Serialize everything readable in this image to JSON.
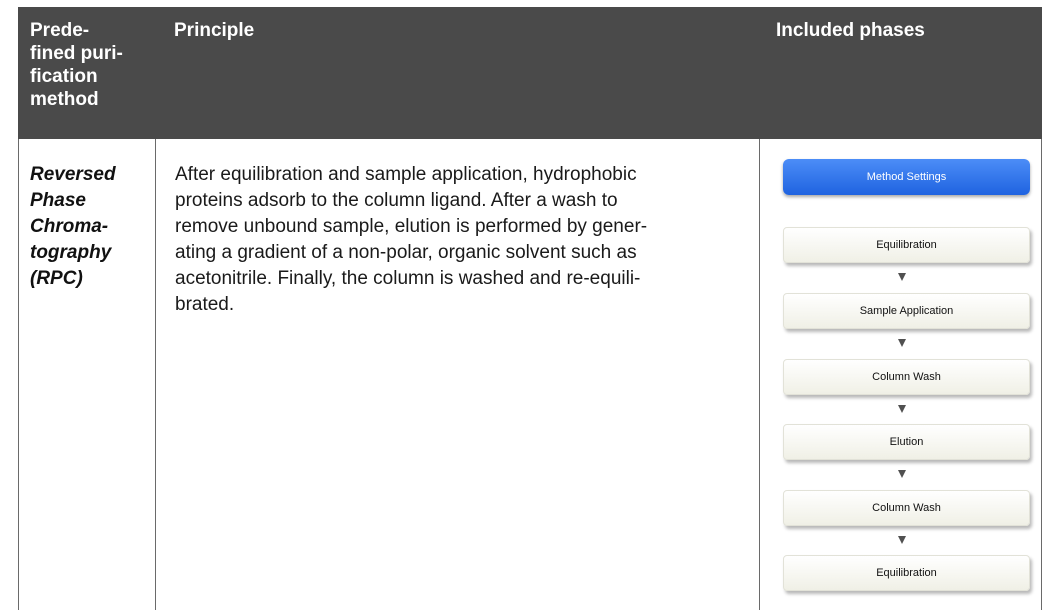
{
  "table": {
    "headers": {
      "method": [
        "Prede-",
        "fined puri-",
        "fication",
        "method"
      ],
      "principle": "Principle",
      "phases": "Included phases"
    },
    "row": {
      "method_lines": [
        "Reversed",
        "Phase",
        "Chroma-",
        "tography",
        "(RPC)"
      ],
      "principle_lines": [
        "After equilibration and sample application, hydrophobic",
        "proteins adsorb to the column ligand. After a wash to",
        "remove unbound sample, elution is performed by gener-",
        "ating a gradient of a non-polar, organic solvent such as",
        "acetonitrile. Finally, the column is washed and re-equili-",
        "brated."
      ],
      "phases": {
        "settings_button": "Method Settings",
        "steps": [
          "Equilibration",
          "Sample Application",
          "Column Wash",
          "Elution",
          "Column Wash",
          "Equilibration"
        ]
      }
    }
  }
}
